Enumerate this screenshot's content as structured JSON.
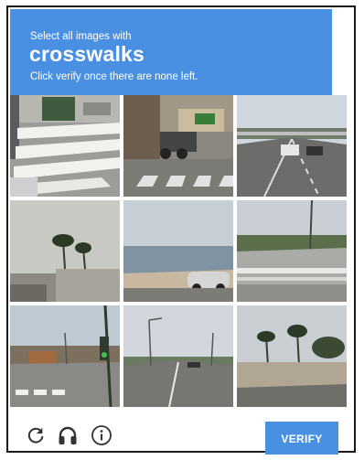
{
  "header": {
    "instruction": "Select all images with",
    "keyword": "crosswalks",
    "subinstruction": "Click verify once there are none left."
  },
  "tiles": [
    {
      "label": "crosswalk with road stripes"
    },
    {
      "label": "street with crosswalk and motorbikes"
    },
    {
      "label": "highway with cars"
    },
    {
      "label": "palm trees and wall"
    },
    {
      "label": "beach with silver car"
    },
    {
      "label": "guardrail along highway"
    },
    {
      "label": "intersection with traffic light and crosswalk"
    },
    {
      "label": "wide road with street lamps"
    },
    {
      "label": "road with palm trees and wall"
    }
  ],
  "footer": {
    "reload_icon": "reload-icon",
    "audio_icon": "headphones-icon",
    "info_icon": "info-icon",
    "verify_label": "VERIFY"
  },
  "colors": {
    "accent": "#4a90e2"
  }
}
